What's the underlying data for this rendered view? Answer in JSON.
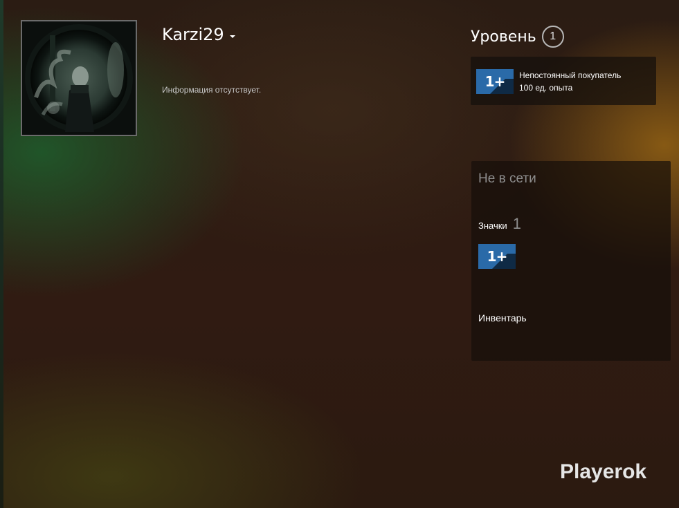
{
  "profile": {
    "persona_name": "Karzi29",
    "summary": "Информация отсутствует."
  },
  "level": {
    "label": "Уровень",
    "value": "1"
  },
  "favorite_badge": {
    "icon_text": "1+",
    "title": "Непостоянный покупатель",
    "xp": "100 ед. опыта"
  },
  "status_panel": {
    "status": "Не в сети",
    "badges_label": "Значки",
    "badges_count": "1",
    "inventory_label": "Инвентарь"
  },
  "watermark": "Playerok",
  "colors": {
    "badge_blue": "#2a6aa8",
    "text_muted": "#8e8e8e"
  }
}
